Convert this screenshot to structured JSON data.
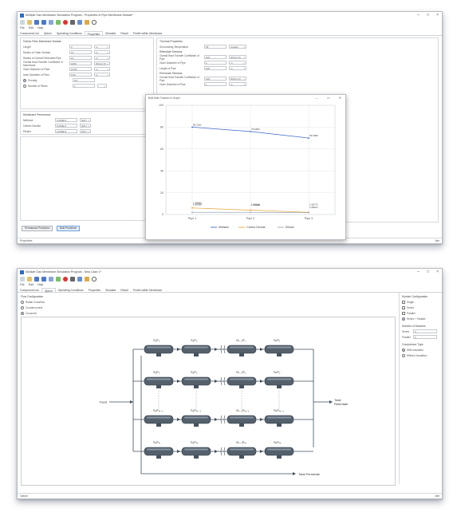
{
  "shot1": {
    "window_title": "Multiple Gas Membrane Simulation Program - Properties of Pipe Membrane Module*",
    "menu": [
      "File",
      "Edit",
      "Help"
    ],
    "tabs": [
      "Component List",
      "Option",
      "Operating Conditions",
      "Properties",
      "Simulate",
      "Result",
      "Profile within Membrane"
    ],
    "active_tab": 3,
    "membrane_section_title": "Hollow Fiber Membrane Module",
    "membrane_rows": [
      {
        "label": "Length",
        "value": "2",
        "unit": "m"
      },
      {
        "label": "Radius of Outer Surface",
        "value": "10",
        "unit": "m"
      },
      {
        "label": "Radius of Central Perforated Pipe",
        "value": "10",
        "unit": "m"
      },
      {
        "label": "Overall Heat Transfer Coefficient of Membrane",
        "value": "1000",
        "unit": "W/(m2·K)"
      },
      {
        "label": "Outer Diameter of Fiber",
        "value": "0.025",
        "unit": "m"
      },
      {
        "label": "Inner Diameter of Fiber",
        "value": "0.02",
        "unit": "m"
      }
    ],
    "porosity_label": "Porosity",
    "porosity_value": "0.5",
    "fibers_label": "Number of Fibers",
    "fibers_value": "1",
    "permeance_title": "Membrane Permeance",
    "permeance_rows": [
      {
        "label": "Methane",
        "value": "1.000E-5",
        "unit": "GPU"
      },
      {
        "label": "Carbon Dioxide",
        "value": "6.000E-5",
        "unit": "GPU"
      },
      {
        "label": "Ethane",
        "value": "2.000E-5",
        "unit": "GPU"
      }
    ],
    "thermal_title": "Thermal Properties",
    "surround_label": "Surrounding Temperature",
    "surround_value": "25",
    "surround_unit": "Celsius",
    "retentate_title": "Retentate Streams",
    "retentate_rows": [
      {
        "label": "Overall Heat Transfer Coefficient of Pipe",
        "value": "100",
        "unit": "W/(m2·K)"
      },
      {
        "label": "Outer Diameter of Pipe",
        "value": "1",
        "unit": "m"
      },
      {
        "label": "Length of Pipe",
        "value": "100",
        "unit": "m"
      }
    ],
    "permeate_title": "Permeate Streams",
    "permeate_rows": [
      {
        "label": "Overall Heat Transfer Coefficient of Pipe",
        "value": "100",
        "unit": "W/(m2·K)"
      },
      {
        "label": "Outer Diameter of Pipe",
        "value": "1",
        "unit": "m"
      }
    ],
    "btn_permeance": "Permeance Prediction",
    "btn_bulk": "Bulk Prediction",
    "status_left": "Properties",
    "status_right": "Idle"
  },
  "chart_popup": {
    "title": "Bulk Mole Fraction in Graph",
    "ctrls": [
      "—",
      "▭",
      "✕"
    ]
  },
  "chart_data": {
    "type": "line",
    "categories": [
      "Pipe 1",
      "Pipe 2",
      "Pipe 3"
    ],
    "ylim": [
      0,
      100
    ],
    "yticks": [
      0,
      20,
      40,
      60,
      80,
      100
    ],
    "grid": true,
    "legend_placement": "bottom",
    "series": [
      {
        "name": "Methane",
        "color": "#3b68c6",
        "values": [
          80,
          76,
          70
        ],
        "labels": [
          "80.1011",
          "76.6834",
          "69.9482"
        ]
      },
      {
        "name": "Carbon Dioxide",
        "color": "#e8a33a",
        "values": [
          6,
          4,
          2
        ],
        "labels": [
          "1.98499",
          "1.75235",
          "1.68517"
        ]
      },
      {
        "name": "Ethane",
        "color": "#9aa7b6",
        "values": [
          2,
          2,
          1.7
        ],
        "labels": [
          "1.99908",
          "1.98168",
          "1.68771"
        ]
      }
    ]
  },
  "shot2": {
    "window_title": "Multiple Gas Membrane Simulation Program - New Case 1*",
    "menu": [
      "File",
      "Edit",
      "Help"
    ],
    "tabs": [
      "Component List",
      "Option",
      "Operating Conditions",
      "Properties",
      "Simulate",
      "Result",
      "Profile within Membrane"
    ],
    "active_tab": 1,
    "flow_title": "Flow Configuration",
    "flow_options": [
      "Radial Crossflow",
      "Countercurrent",
      "Cocurrent"
    ],
    "flow_selected": 2,
    "module_title": "Module Configuration",
    "module_options": [
      "Single",
      "Series",
      "Parallel",
      "Series + Parallel"
    ],
    "module_selected": 3,
    "num_title": "Number of Modules",
    "series_label": "Series",
    "series_value": "3",
    "parallel_label": "Parallel",
    "parallel_value": "3",
    "compressor_title": "Compressor Type",
    "compressor_options": [
      "With Insulation",
      "Without Insulation"
    ],
    "compressor_selected": 0,
    "feed_label": "Feed",
    "retentate_label": "Total\nRetentate",
    "permeate_label": "Total Permeate",
    "modules": [
      [
        "S₁P₁",
        "S₂P₁",
        "Sₙ₋₁P₁",
        "SₙP₁"
      ],
      [
        "S₁P₂",
        "S₂P₂",
        "Sₙ₋₁P₂",
        "SₙP₂"
      ],
      [
        "S₁Pₘ₋₁",
        "S₂Pₘ₋₁",
        "Sₙ₋₁Pₘ₋₁",
        "SₙPₘ₋₁"
      ],
      [
        "S₁Pₘ",
        "S₂Pₘ",
        "Sₙ₋₁Pₘ",
        "SₙPₘ"
      ]
    ],
    "status_left": "Option",
    "status_right": "Idle"
  }
}
